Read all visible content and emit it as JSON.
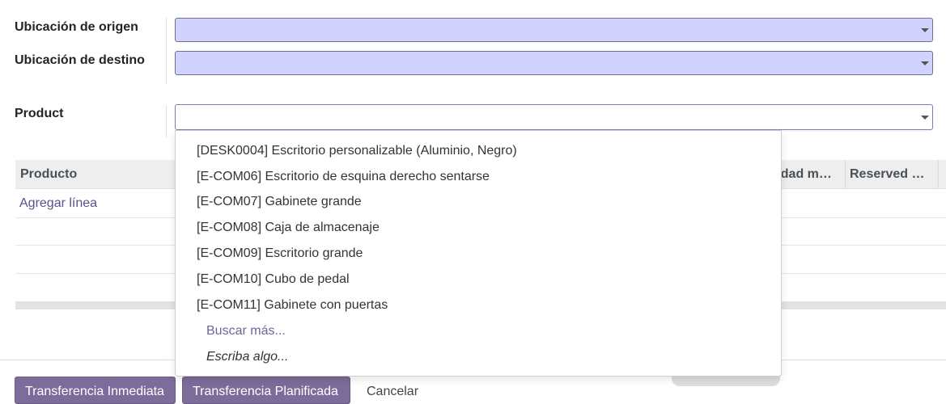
{
  "form": {
    "source_location_label": "Ubicación de origen",
    "dest_location_label": "Ubicación de destino",
    "product_label": "Product"
  },
  "table": {
    "columns": [
      "Producto",
      "tidad m…",
      "Reserved …"
    ],
    "add_line": "Agregar línea"
  },
  "dropdown": {
    "items": [
      "[DESK0004] Escritorio personalizable (Aluminio, Negro)",
      "[E-COM06] Escritorio de esquina derecho sentarse",
      "[E-COM07] Gabinete grande",
      "[E-COM08] Caja de almacenaje",
      "[E-COM09] Escritorio grande",
      "[E-COM10] Cubo de pedal",
      "[E-COM11] Gabinete con puertas"
    ],
    "search_more": "Buscar más...",
    "type_hint": "Escriba algo..."
  },
  "footer": {
    "immediate_label": "Transferencia Inmediata",
    "planned_label": "Transferencia Planificada",
    "cancel_label": "Cancelar"
  },
  "colors": {
    "required_field_bg": "#d2d2ff",
    "primary_button": "#7c6c99",
    "link": "#5b4f8c"
  }
}
